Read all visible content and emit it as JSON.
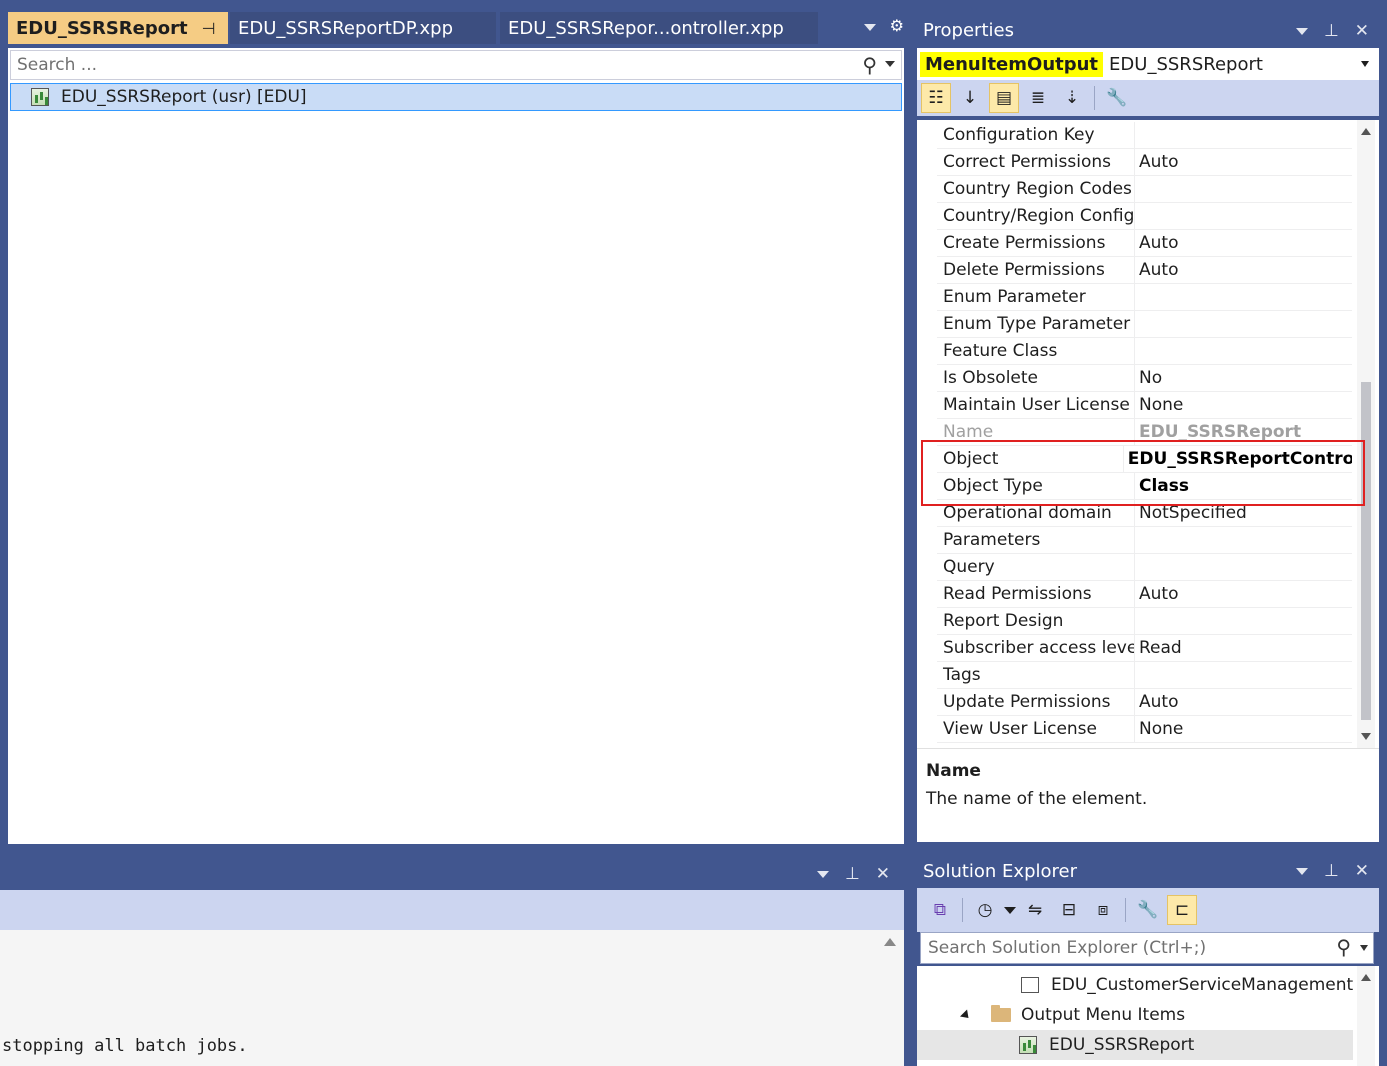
{
  "editor": {
    "tabs": [
      {
        "label": "EDU_SSRSReport"
      },
      {
        "label": "EDU_SSRSReportDP.xpp"
      },
      {
        "label": "EDU_SSRSRepor...ontroller.xpp"
      }
    ],
    "search_placeholder": "Search ...",
    "tree_item": "EDU_SSRSReport (usr) [EDU]"
  },
  "output": {
    "last_line": "stopping all batch jobs."
  },
  "properties": {
    "title": "Properties",
    "object_type": "MenuItemOutput",
    "object_name": "EDU_SSRSReport",
    "rows": [
      {
        "name": "Configuration Key",
        "value": ""
      },
      {
        "name": "Correct Permissions",
        "value": "Auto"
      },
      {
        "name": "Country Region Codes",
        "value": ""
      },
      {
        "name": "Country/Region Configu",
        "value": ""
      },
      {
        "name": "Create Permissions",
        "value": "Auto"
      },
      {
        "name": "Delete Permissions",
        "value": "Auto"
      },
      {
        "name": "Enum Parameter",
        "value": ""
      },
      {
        "name": "Enum Type Parameter",
        "value": ""
      },
      {
        "name": "Feature Class",
        "value": ""
      },
      {
        "name": "Is Obsolete",
        "value": "No"
      },
      {
        "name": "Maintain User License",
        "value": "None"
      },
      {
        "name": "Name",
        "value": "EDU_SSRSReport"
      },
      {
        "name": "Object",
        "value": "EDU_SSRSReportControll"
      },
      {
        "name": "Object Type",
        "value": "Class"
      },
      {
        "name": "Operational domain",
        "value": "NotSpecified"
      },
      {
        "name": "Parameters",
        "value": ""
      },
      {
        "name": "Query",
        "value": ""
      },
      {
        "name": "Read Permissions",
        "value": "Auto"
      },
      {
        "name": "Report Design",
        "value": ""
      },
      {
        "name": "Subscriber access level",
        "value": "Read"
      },
      {
        "name": "Tags",
        "value": ""
      },
      {
        "name": "Update Permissions",
        "value": "Auto"
      },
      {
        "name": "View User License",
        "value": "None"
      }
    ],
    "description_title": "Name",
    "description_text": "The name of the element."
  },
  "solution_explorer": {
    "title": "Solution Explorer",
    "search_placeholder": "Search Solution Explorer (Ctrl+;)",
    "items": [
      {
        "label": "EDU_CustomerServiceManagement"
      },
      {
        "label": "Output Menu Items"
      },
      {
        "label": "EDU_SSRSReport"
      }
    ]
  },
  "colors": {
    "chrome": "#41568f",
    "active_tab": "#f5cc84",
    "highlight": "#ffff00",
    "annotation_box": "#e02020"
  }
}
